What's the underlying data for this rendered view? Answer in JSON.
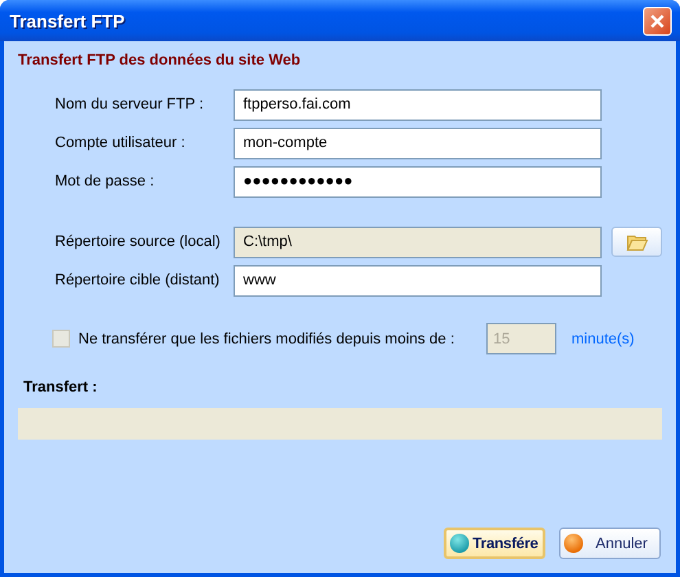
{
  "window": {
    "title": "Transfert FTP"
  },
  "heading": "Transfert FTP des données du site Web",
  "fields": [
    {
      "label": "Nom du serveur FTP :",
      "value": "ftpperso.fai.com",
      "readonly": false,
      "browse": false
    },
    {
      "label": "Compte utilisateur :",
      "value": "mon-compte",
      "readonly": false,
      "browse": false
    },
    {
      "label": "Mot de passe :",
      "value": "●●●●●●●●●●●●",
      "readonly": false,
      "browse": false
    },
    {
      "label": "Répertoire source (local)",
      "value": "C:\\tmp\\",
      "readonly": true,
      "browse": true
    },
    {
      "label": "Répertoire cible (distant)",
      "value": "www",
      "readonly": false,
      "browse": false
    }
  ],
  "filter": {
    "label": "Ne transférer que les fichiers modifiés depuis moins de :",
    "checked": false,
    "disabled": true,
    "value": "15",
    "unit": "minute(s)"
  },
  "transfer": {
    "label": "Transfert :",
    "level": 0
  },
  "buttons": [
    {
      "label": "Transfére",
      "kind": "confirm",
      "default": true
    },
    {
      "label": "Annuler",
      "kind": "cancel",
      "default": false
    }
  ]
}
